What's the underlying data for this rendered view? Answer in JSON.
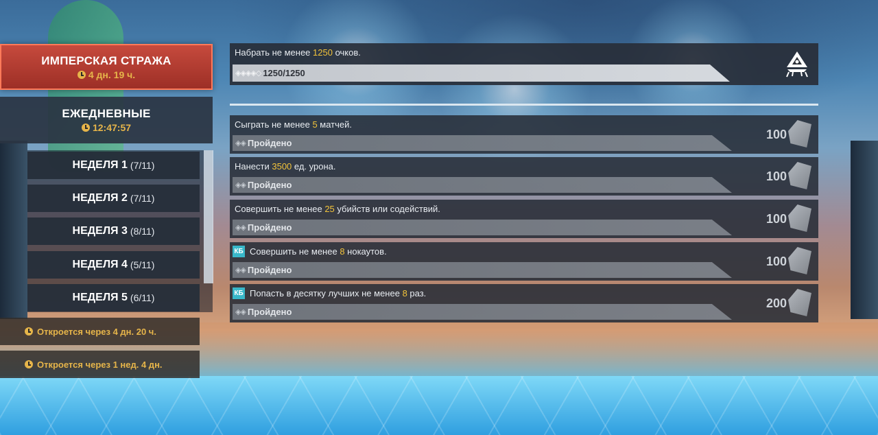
{
  "nav": {
    "imperial": {
      "title": "ИМПЕРСКАЯ СТРАЖА",
      "timer": "4 дн. 19 ч."
    },
    "daily": {
      "title": "ЕЖЕДНЕВНЫЕ",
      "timer": "12:47:57"
    },
    "weeks": [
      {
        "label": "НЕДЕЛЯ 1",
        "count": "(7/11)"
      },
      {
        "label": "НЕДЕЛЯ 2",
        "count": "(7/11)"
      },
      {
        "label": "НЕДЕЛЯ 3",
        "count": "(8/11)"
      },
      {
        "label": "НЕДЕЛЯ 4",
        "count": "(5/11)"
      },
      {
        "label": "НЕДЕЛЯ 5",
        "count": "(6/11)"
      }
    ],
    "locked": [
      {
        "text": "Откроется через 4 дн. 20 ч."
      },
      {
        "text": "Откроется через 1 нед. 4 дн."
      }
    ]
  },
  "top_challenge": {
    "text_pre": "Набрать не менее ",
    "highlight": "1250",
    "text_post": " очков.",
    "diamonds": "◈◈◈◈◇",
    "progress": "1250/1250",
    "progress_fraction": 1.0,
    "icon": "imperial-guard-emblem-icon"
  },
  "challenges": [
    {
      "badge": "",
      "text_pre": "Сыграть не менее ",
      "highlight": "5",
      "text_post": " матчей.",
      "diamonds": "◈◈",
      "status": "Пройдено",
      "reward": "100",
      "icon": "battlepass-star-icon"
    },
    {
      "badge": "",
      "text_pre": "Нанести ",
      "highlight": "3500",
      "text_post": " ед. урона.",
      "diamonds": "◈◈",
      "status": "Пройдено",
      "reward": "100",
      "icon": "battlepass-star-icon"
    },
    {
      "badge": "",
      "text_pre": "Совершить не менее ",
      "highlight": "25",
      "text_post": " убийств или содействий.",
      "diamonds": "◈◈",
      "status": "Пройдено",
      "reward": "100",
      "icon": "battlepass-star-icon"
    },
    {
      "badge": "КБ",
      "text_pre": "Совершить не менее ",
      "highlight": "8",
      "text_post": " нокаутов.",
      "diamonds": "◈◈",
      "status": "Пройдено",
      "reward": "100",
      "icon": "battlepass-star-icon"
    },
    {
      "badge": "КБ",
      "text_pre": "Попасть в десятку лучших не менее ",
      "highlight": "8",
      "text_post": " раз.",
      "diamonds": "◈◈",
      "status": "Пройдено",
      "reward": "200",
      "icon": "battlepass-star-icon"
    }
  ],
  "colors": {
    "accent_gold": "#e6b54a",
    "highlight_yellow": "#f2c33a",
    "active_tab": "#c64a3d",
    "badge_teal": "#39b7c9"
  }
}
